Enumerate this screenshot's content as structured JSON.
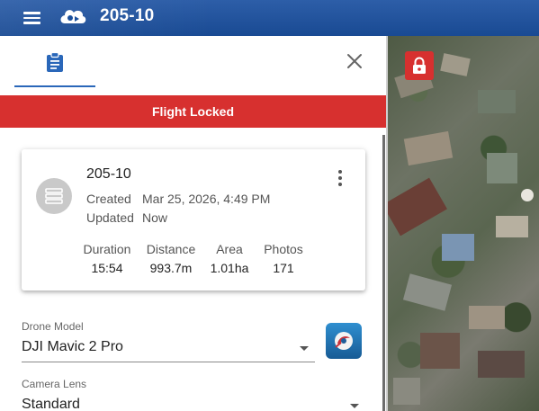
{
  "app": {
    "title": "205-10"
  },
  "panel": {
    "tab_icon": "clipboard-icon",
    "close_icon": "close-icon",
    "banner": "Flight Locked"
  },
  "card": {
    "title": "205-10",
    "created_label": "Created",
    "created_value": "Mar 25, 2026, 4:49 PM",
    "updated_label": "Updated",
    "updated_value": "Now",
    "stats": [
      {
        "label": "Duration",
        "value": "15:54"
      },
      {
        "label": "Distance",
        "value": "993.7m"
      },
      {
        "label": "Area",
        "value": "1.01ha"
      },
      {
        "label": "Photos",
        "value": "171"
      }
    ]
  },
  "form": {
    "drone_model_label": "Drone Model",
    "drone_model_value": "DJI Mavic 2 Pro",
    "camera_lens_label": "Camera Lens",
    "camera_lens_value": "Standard"
  },
  "map": {
    "lock_icon": "lock-icon"
  },
  "colors": {
    "appbar": "#1a4f9c",
    "accent": "#2a67b9",
    "danger": "#d7302f"
  }
}
